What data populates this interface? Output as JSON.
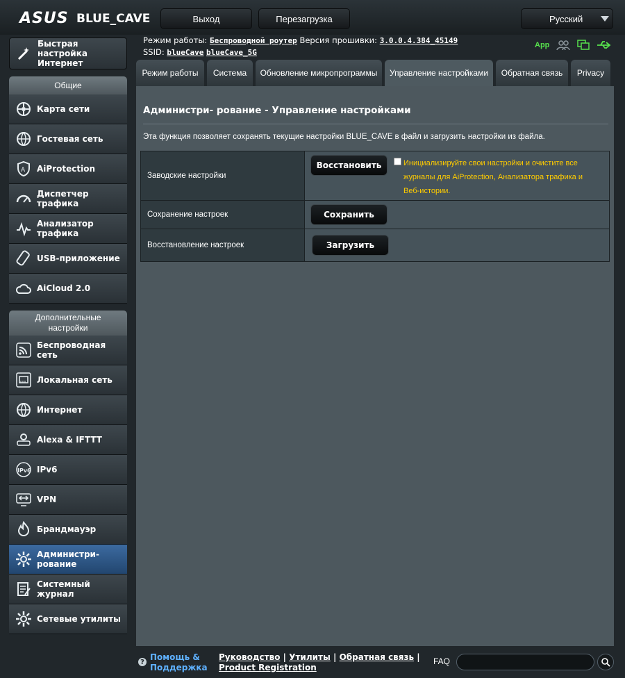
{
  "header": {
    "logo": "ASUS",
    "model": "BLUE_CAVE",
    "logout_label": "Выход",
    "reboot_label": "Перезагрузка",
    "language": "Русский"
  },
  "status": {
    "mode_label": "Режим работы:",
    "mode_value": "Беспроводной роутер",
    "firmware_label": "Версия прошивки:",
    "firmware_value": "3.0.0.4.384_45149",
    "ssid_label": "SSID:",
    "ssid_1": "blueCave",
    "ssid_2": "blueCave_5G",
    "app_label": "App"
  },
  "sidebar": {
    "quick_setup": "Быстрая настройка Интернет",
    "general_title": "Общие",
    "general": [
      {
        "label": "Карта сети",
        "icon": "network-map-icon"
      },
      {
        "label": "Гостевая сеть",
        "icon": "guest-network-icon"
      },
      {
        "label": "AiProtection",
        "icon": "shield-icon"
      },
      {
        "label": "Диспетчер трафика",
        "icon": "gauge-icon"
      },
      {
        "label": "Анализатор трафика",
        "icon": "traffic-analyzer-icon"
      },
      {
        "label": "USB-приложение",
        "icon": "usb-icon"
      },
      {
        "label": "AiCloud 2.0",
        "icon": "cloud-icon"
      }
    ],
    "advanced_title": "Дополнительные настройки",
    "advanced": [
      {
        "label": "Беспроводная сеть",
        "icon": "wireless-icon"
      },
      {
        "label": "Локальная сеть",
        "icon": "lan-icon"
      },
      {
        "label": "Интернет",
        "icon": "globe-icon"
      },
      {
        "label": "Alexa & IFTTT",
        "icon": "alexa-icon"
      },
      {
        "label": "IPv6",
        "icon": "ipv6-icon"
      },
      {
        "label": "VPN",
        "icon": "vpn-icon"
      },
      {
        "label": "Брандмауэр",
        "icon": "firewall-icon"
      },
      {
        "label": "Администри- рование",
        "icon": "gear-icon",
        "active": true
      },
      {
        "label": "Системный журнал",
        "icon": "log-icon"
      },
      {
        "label": "Сетевые утилиты",
        "icon": "tools-icon"
      }
    ]
  },
  "tabs": [
    {
      "label": "Режим работы"
    },
    {
      "label": "Система"
    },
    {
      "label": "Обновление микропрограммы"
    },
    {
      "label": "Управление настройками",
      "active": true
    },
    {
      "label": "Обратная связь"
    },
    {
      "label": "Privacy"
    }
  ],
  "main": {
    "title": "Администри- рование - Управление настройками",
    "description": "Эта функция позволяет сохранять текущие настройки BLUE_CAVE в файл и загрузить настройки из файла.",
    "rows": [
      {
        "label": "Заводские настройки",
        "button": "Восстановить",
        "note": "Инициализируйте свои настройки и очистите все журналы для AiProtection, Анализатора трафика и Веб-истории."
      },
      {
        "label": "Сохранение настроек",
        "button": "Сохранить"
      },
      {
        "label": "Восстановление настроек",
        "button": "Загрузить"
      }
    ]
  },
  "footer": {
    "help": "Помощь & Поддержка",
    "links": [
      "Руководство",
      "Утилиты",
      "Обратная связь",
      "Product Registration"
    ],
    "faq": "FAQ",
    "search_placeholder": ""
  }
}
